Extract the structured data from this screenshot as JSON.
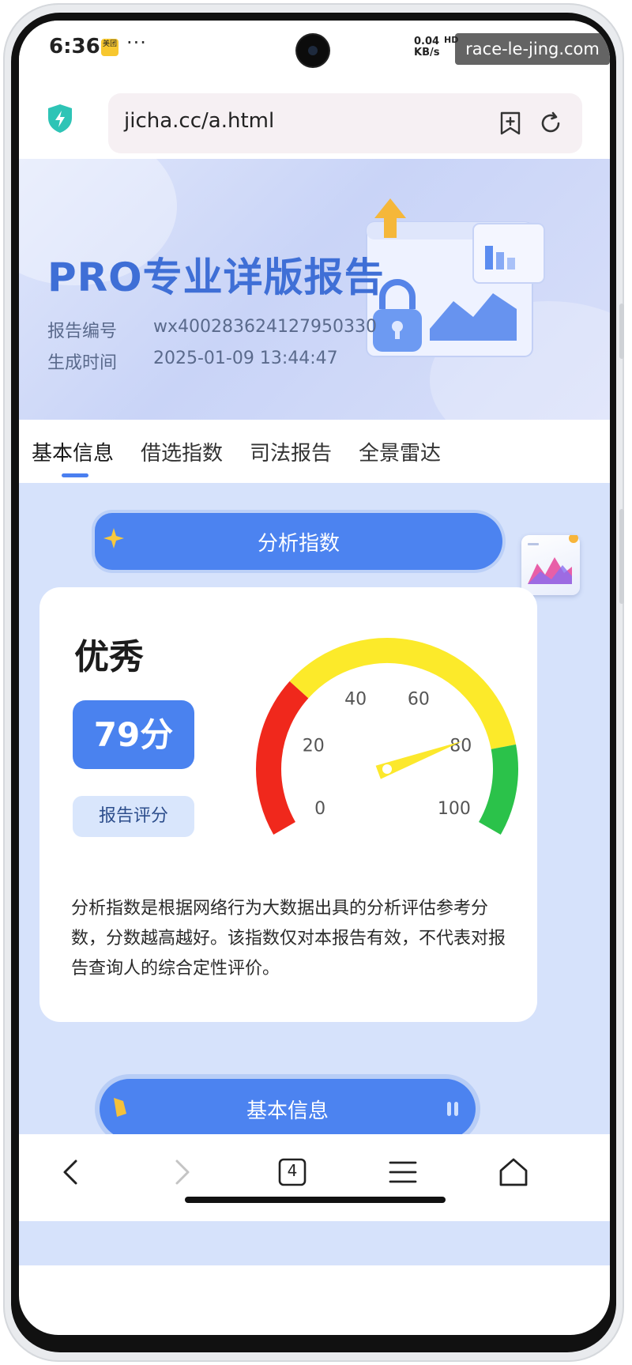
{
  "status_bar": {
    "time": "6:36",
    "app_badge": "美团",
    "more_indicator": "···",
    "net_speed_value": "0.04",
    "net_speed_unit": "KB/s",
    "network_type": "HD",
    "watermark": "race-le-jing.com"
  },
  "browser": {
    "url": "jicha.cc/a.html",
    "open_tabs": "4"
  },
  "banner": {
    "title": "PRO专业详版报告",
    "report_no_label": "报告编号",
    "report_no_value": "wx400283624127950330",
    "generated_label": "生成时间",
    "generated_value": "2025-01-09 13:44:47"
  },
  "tabs": [
    {
      "label": "基本信息",
      "active": true
    },
    {
      "label": "借选指数",
      "active": false
    },
    {
      "label": "司法报告",
      "active": false
    },
    {
      "label": "全景雷达",
      "active": false
    }
  ],
  "section": {
    "title": "分析指数"
  },
  "score_card": {
    "rating": "优秀",
    "score": "79分",
    "score_value": 79,
    "caption": "报告评分",
    "description": "分析指数是根据网络行为大数据出具的分析评估参考分数，分数越高越好。该指数仅对本报告有效，不代表对报告查询人的综合定性评价。"
  },
  "gauge": {
    "min": 0,
    "max": 100,
    "value": 79,
    "ticks": [
      "0",
      "20",
      "40",
      "60",
      "80",
      "100"
    ],
    "colors": {
      "low": "#f0281c",
      "mid": "#fcea2a",
      "high": "#2bc24a",
      "needle": "#fce82c"
    }
  },
  "next_section": {
    "title": "基本信息"
  },
  "colors": {
    "accent": "#4a82ef",
    "banner_title": "#3f6fd6",
    "content_bg": "#d6e2fb"
  },
  "icons": {
    "security": "shield-icon",
    "bookmark": "bookmark-add-icon",
    "reload": "reload-icon",
    "back": "back-icon",
    "forward": "forward-icon",
    "tabs": "tabs-icon",
    "menu": "menu-icon",
    "home": "home-icon"
  }
}
